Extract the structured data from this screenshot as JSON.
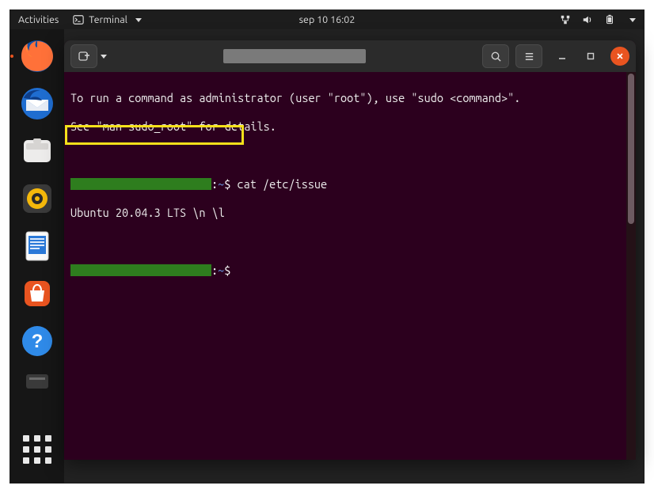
{
  "panel": {
    "activities": "Activities",
    "app_name": "Terminal",
    "clock": "sep 10  16:02"
  },
  "window": {
    "controls": {
      "minimize_tooltip": "Minimize",
      "maximize_tooltip": "Maximize",
      "close_tooltip": "Close"
    }
  },
  "terminal": {
    "line1": "To run a command as administrator (user \"root\"), use \"sudo <command>\".",
    "line2": "See \"man sudo_root\" for details.",
    "prompt_sep": ":",
    "prompt_path": "~",
    "prompt_dollar": "$",
    "cmd1": " cat /etc/issue",
    "output1": "Ubuntu 20.04.3 LTS \\n \\l"
  },
  "dock": {
    "items": [
      {
        "name": "firefox"
      },
      {
        "name": "thunderbird"
      },
      {
        "name": "files"
      },
      {
        "name": "rhythmbox"
      },
      {
        "name": "libreoffice-writer"
      },
      {
        "name": "ubuntu-software"
      },
      {
        "name": "help"
      }
    ]
  },
  "icons": {
    "network": "network-icon",
    "volume": "volume-icon",
    "battery": "battery-icon",
    "search": "search-icon",
    "hamburger": "hamburger-icon",
    "newtab": "new-tab-icon"
  }
}
